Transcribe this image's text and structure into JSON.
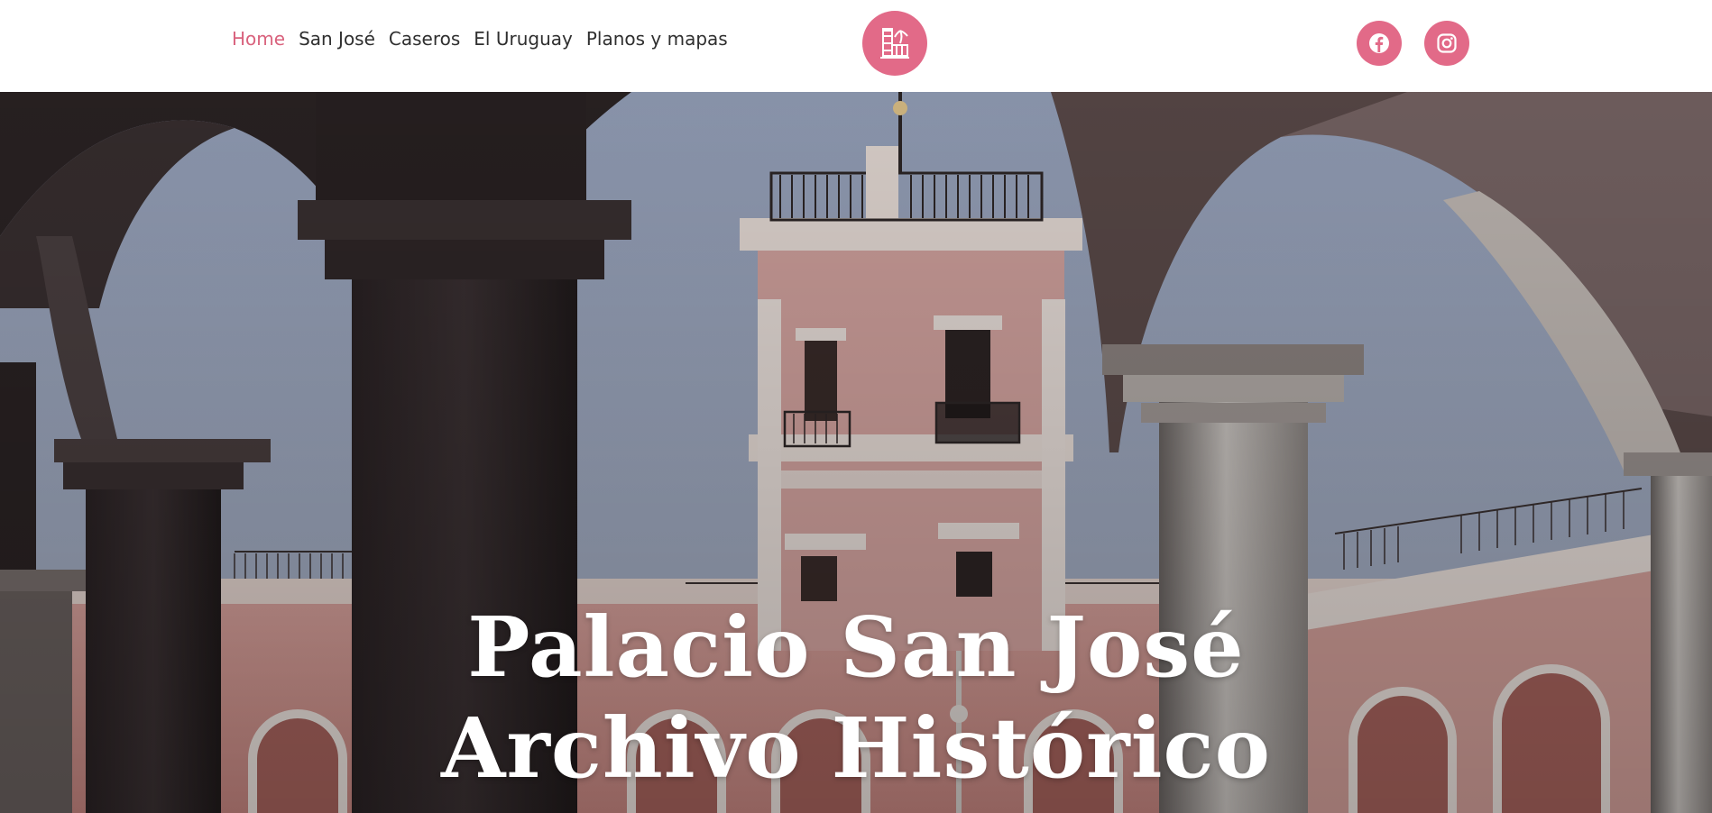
{
  "nav": {
    "items": [
      {
        "label": "Home",
        "active": true
      },
      {
        "label": "San José",
        "active": false
      },
      {
        "label": "Caseros",
        "active": false
      },
      {
        "label": "El Uruguay",
        "active": false
      },
      {
        "label": "Planos y mapas",
        "active": false
      }
    ]
  },
  "logo": {
    "icon": "palace-logo-icon"
  },
  "social": {
    "facebook_icon": "facebook-icon",
    "instagram_icon": "instagram-icon"
  },
  "hero": {
    "title_line1": "Palacio San José",
    "title_line2": "Archivo Histórico"
  },
  "colors": {
    "accent": "#e26a88",
    "active_nav": "#d9627d",
    "nav_text": "#2f2f2f"
  }
}
